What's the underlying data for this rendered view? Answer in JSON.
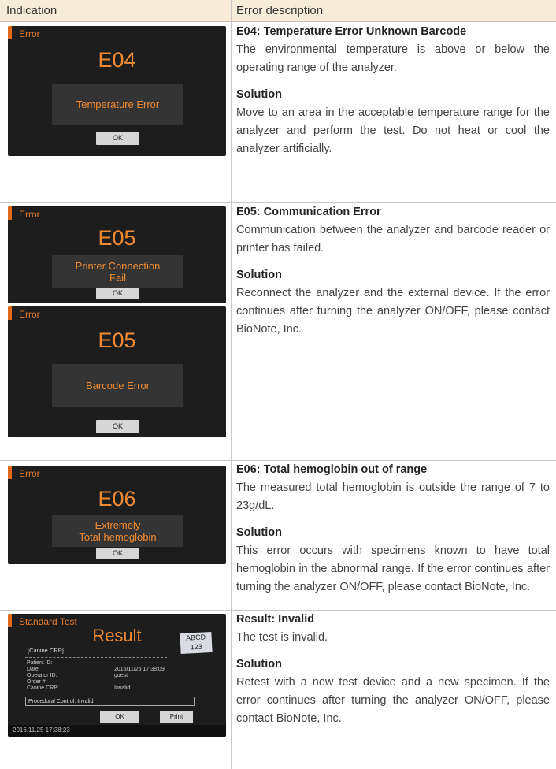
{
  "header": {
    "col1": "Indication",
    "col2": "Error description"
  },
  "rows": {
    "e04": {
      "screen": {
        "title": "Error",
        "code": "E04",
        "message": [
          "Temperature Error"
        ],
        "button": "OK"
      },
      "heading": "E04: Temperature Error Unknown Barcode",
      "description": "The environmental temperature is above or below the operating range of the analyzer.",
      "solution_label": "Solution",
      "solution": "Move to an area in the acceptable temperature range for the analyzer and perform the test. Do not heat or cool the analyzer artificially."
    },
    "e05": {
      "screen1": {
        "title": "Error",
        "code": "E05",
        "message": [
          "Printer Connection",
          "Fail"
        ],
        "button": "OK"
      },
      "screen2": {
        "title": "Error",
        "code": "E05",
        "message": [
          "Barcode Error"
        ],
        "button": "OK"
      },
      "heading": "E05: Communication Error",
      "description": "Communication between the analyzer and barcode reader or printer has failed.",
      "solution_label": "Solution",
      "solution": "Reconnect the analyzer and the external device. If the error continues after turning the analyzer ON/OFF, please contact BioNote, Inc."
    },
    "e06": {
      "screen": {
        "title": "Error",
        "code": "E06",
        "message": [
          "Extremely",
          "Total hemoglobin"
        ],
        "button": "OK"
      },
      "heading": "E06: Total hemoglobin out of range",
      "description": "The measured total hemoglobin is outside the range of 7 to 23g/dL.",
      "solution_label": "Solution",
      "solution": "This error occurs with specimens known to have total hemoglobin in the abnormal range. If the error continues after turning the analyzer ON/OFF, please contact BioNote, Inc."
    },
    "invalid": {
      "screen": {
        "title": "Standard Test",
        "result_title": "Result",
        "stamp": [
          "ABCD",
          "123"
        ],
        "test_name": "[Canine CRP]",
        "fields": [
          {
            "label": "Patient ID:",
            "value": ""
          },
          {
            "label": "Date:",
            "value": "2016/11/25 17:38:09"
          },
          {
            "label": "Operator ID:",
            "value": "guest"
          },
          {
            "label": "Order #:",
            "value": ""
          },
          {
            "label": "Canine CRP:",
            "value": "Invalid"
          }
        ],
        "procedural": "Procedural Control: Invalid",
        "ok": "OK",
        "print": "Print",
        "timestamp": "2016.11.25  17:38:23"
      },
      "heading": "Result: Invalid",
      "description": "The test is invalid.",
      "solution_label": "Solution",
      "solution": "Retest with a new test device and a new specimen. If the error continues after turning the analyzer ON/OFF, please contact BioNote, Inc."
    }
  }
}
